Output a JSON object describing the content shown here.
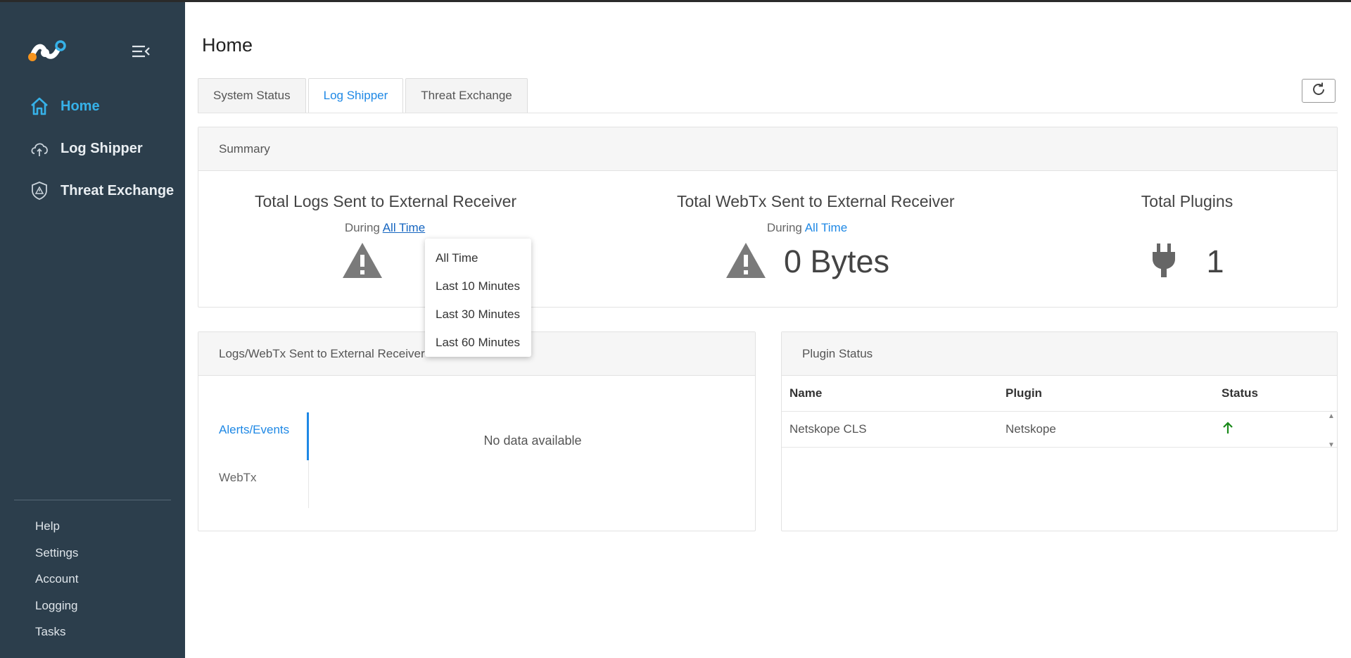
{
  "sidebar": {
    "nav_items": [
      {
        "label": "Home",
        "icon": "home-icon"
      },
      {
        "label": "Log Shipper",
        "icon": "cloud-upload-icon"
      },
      {
        "label": "Threat Exchange",
        "icon": "shield-alert-icon"
      }
    ],
    "footer_items": [
      "Help",
      "Settings",
      "Account",
      "Logging",
      "Tasks"
    ]
  },
  "page": {
    "title": "Home"
  },
  "tabs": [
    "System Status",
    "Log Shipper",
    "Threat Exchange"
  ],
  "summary": {
    "header": "Summary",
    "stats": [
      {
        "title": "Total Logs Sent to External Receiver",
        "during_label": "During",
        "period": "All Time",
        "icon": "warning-icon",
        "value": ""
      },
      {
        "title": "Total WebTx Sent to External Receiver",
        "during_label": "During",
        "period": "All Time",
        "icon": "warning-icon",
        "value": "0 Bytes"
      },
      {
        "title": "Total Plugins",
        "icon": "plug-icon",
        "value": "1"
      }
    ]
  },
  "period_dropdown": {
    "options": [
      "All Time",
      "Last 10 Minutes",
      "Last 30 Minutes",
      "Last 60 Minutes"
    ]
  },
  "logs_card": {
    "header": "Logs/WebTx Sent to External Receiver",
    "tabs": [
      "Alerts/Events",
      "WebTx"
    ],
    "empty_text": "No data available"
  },
  "plugin_card": {
    "header": "Plugin Status",
    "columns": [
      "Name",
      "Plugin",
      "Status"
    ],
    "rows": [
      {
        "name": "Netskope CLS",
        "plugin": "Netskope",
        "status_icon": "arrow-up-icon"
      }
    ]
  },
  "colors": {
    "sidebar_bg": "#2c3e4c",
    "accent": "#36b1e8",
    "link": "#1e88e5",
    "status_up": "#1a8a1a"
  }
}
